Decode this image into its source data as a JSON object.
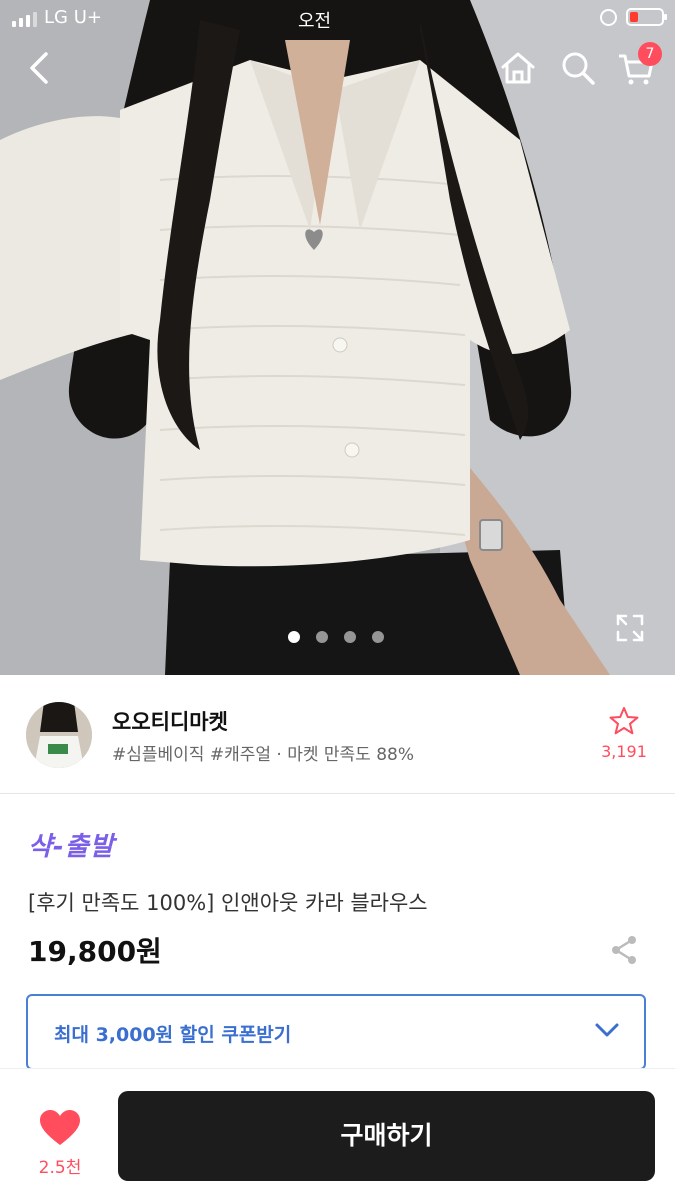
{
  "status_bar": {
    "carrier": "LG U+",
    "time": "오전"
  },
  "nav": {
    "cart_count": "7"
  },
  "icons": {
    "back": "chevron-left-icon",
    "home": "home-icon",
    "search": "search-icon",
    "cart": "cart-icon",
    "expand": "expand-icon",
    "favorite": "star-outline-icon",
    "share": "share-icon",
    "coupon_toggle": "chevron-down-icon",
    "like": "heart-icon"
  },
  "gallery": {
    "image_count": 4,
    "active_index": 0
  },
  "shop": {
    "name": "오오티디마켓",
    "tags": "#심플베이직 #캐주얼 · 마켓 만족도 88%",
    "favorite_count": "3,191"
  },
  "product": {
    "badge": "샥-출발",
    "title": "[후기 만족도 100%] 인앤아웃 카라 블라우스",
    "price": "19,800원"
  },
  "coupon": {
    "label": "최대 3,000원 할인 쿠폰받기"
  },
  "bottom": {
    "like_count": "2.5천",
    "buy_label": "구매하기"
  },
  "colors": {
    "accent_red": "#ff4d5e",
    "badge_purple": "#7b5fe8",
    "coupon_blue": "#3a6fd0",
    "buy_button": "#1c1c1c"
  }
}
